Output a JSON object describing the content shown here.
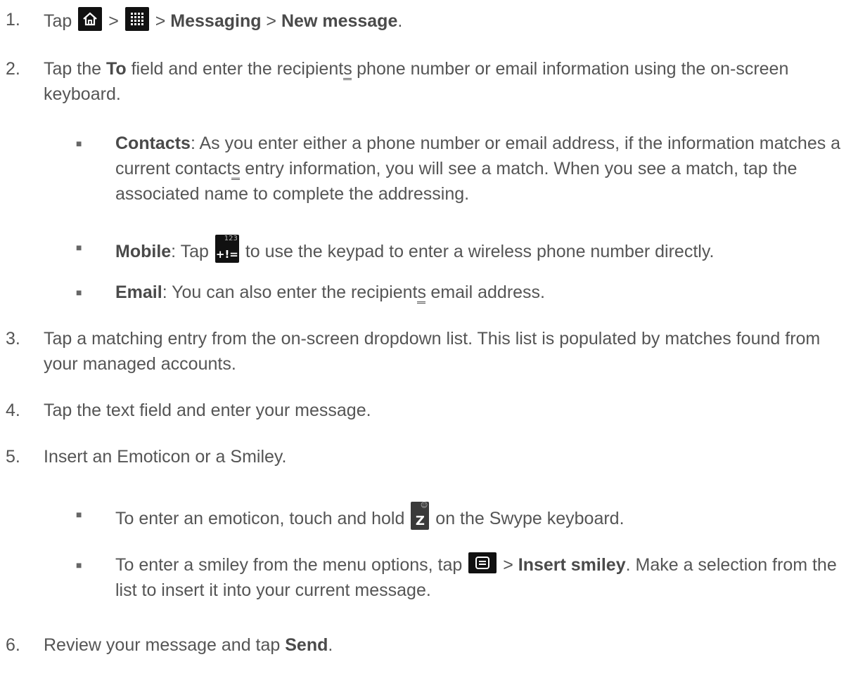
{
  "steps": [
    {
      "num": "1.",
      "parts": [
        "Tap",
        ">",
        "> ",
        "Messaging",
        " > ",
        "New message",
        "."
      ]
    },
    {
      "num": "2.",
      "parts": [
        "Tap the ",
        "To",
        " field and enter the recipient",
        "s",
        " phone number or email information using the on-screen keyboard."
      ]
    },
    {
      "num": "3.",
      "text": "Tap a matching entry from the on-screen dropdown list. This list is populated by matches found from your managed accounts."
    },
    {
      "num": "4.",
      "text": "Tap the text field and enter your message."
    },
    {
      "num": "5.",
      "text": "Insert an Emoticon or a Smiley."
    },
    {
      "num": "6.",
      "parts": [
        "Review your message and tap ",
        "Send",
        "."
      ]
    }
  ],
  "bullets": {
    "contacts": {
      "label": "Contacts",
      "parts": [
        ": As you enter either a phone number or email address, if the information matches a current contact",
        "s",
        " entry information, you will see a match. When you see a match, tap the associated name to complete the addressing."
      ]
    },
    "mobile": {
      "label": "Mobile",
      "parts": [
        ": Tap ",
        " to use the keypad to enter a wireless phone number directly."
      ]
    },
    "email": {
      "label": "Email",
      "parts": [
        ": You can also enter the recipient",
        "s",
        " email address."
      ]
    },
    "emoticon": {
      "parts": [
        "To enter an emoticon, touch and hold ",
        " on the Swype keyboard."
      ]
    },
    "smiley": {
      "parts": [
        "To enter a smiley from the menu options, tap ",
        " > ",
        "Insert smiley",
        ". Make a selection from the list to insert it into your current message."
      ]
    }
  },
  "bullet_char": "■",
  "icons": {
    "home": "home-icon",
    "apps": "apps-grid-icon",
    "keypad": "keypad-123-icon",
    "keypad_sup": "123",
    "keypad_main": "+!=",
    "swype_z": "swype-z-key-icon",
    "swype_z_sup": "☺",
    "swype_z_main": "Z",
    "menu": "menu-icon"
  },
  "colors": {
    "text": "#555555",
    "bold": "#4a4a4a",
    "icon_bg": "#111111",
    "icon_fg": "#ffffff"
  }
}
